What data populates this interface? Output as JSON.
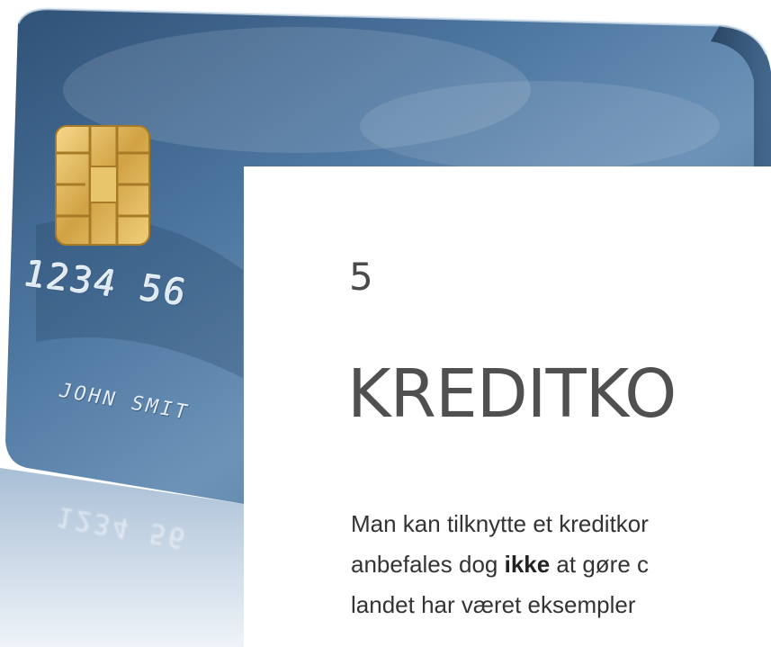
{
  "card": {
    "number": "1234 56",
    "name": "JOHN SMIT",
    "mirror_text": "1234 56",
    "colors": {
      "card_dark": "#2c4a6e",
      "card_mid": "#4f77a0",
      "card_light": "#9bbad6",
      "chip": "#d7a94a"
    },
    "chip_icon": "card-chip-icon"
  },
  "chapter": {
    "number": "5",
    "title": "KREDITKO"
  },
  "paragraph": {
    "line1": "Man kan tilknytte et kreditkor",
    "line2_before": "anbefales dog ",
    "line2_bold": "ikke",
    "line2_after": " at gøre c",
    "line3": "landet har været eksempler"
  }
}
